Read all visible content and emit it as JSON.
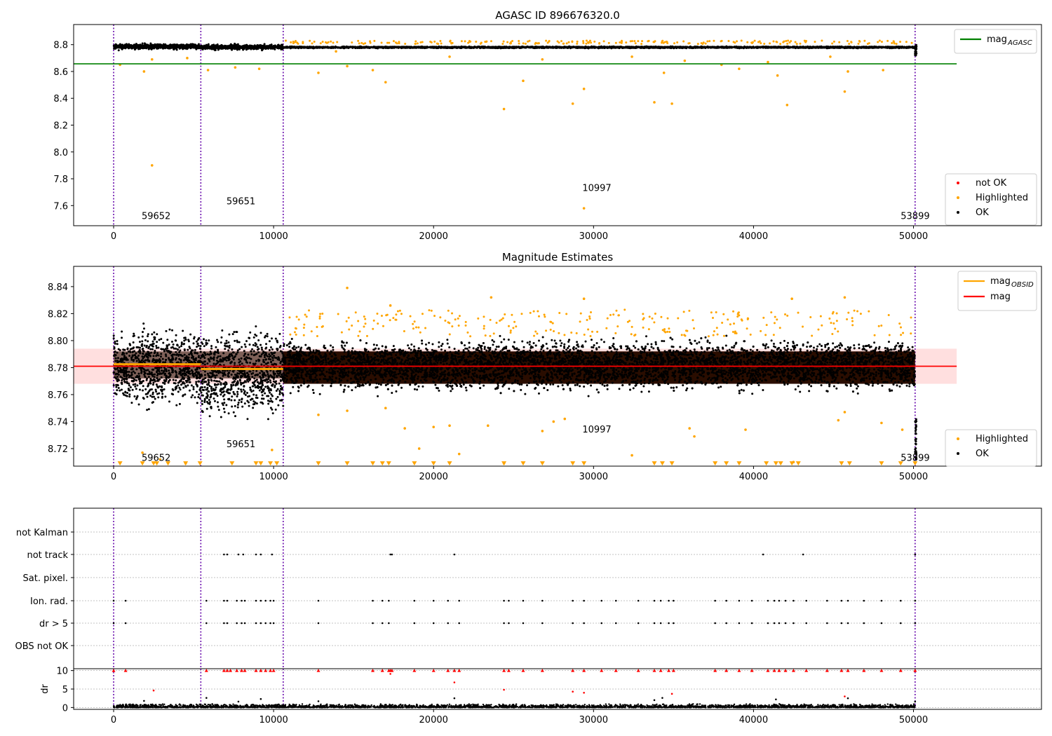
{
  "chart_data": [
    {
      "type": "scatter",
      "title": "AGASC ID 896676320.0",
      "xlim": [
        -2500,
        58000
      ],
      "ylim": [
        7.45,
        8.95
      ],
      "xticks": [
        0,
        10000,
        20000,
        30000,
        40000,
        50000
      ],
      "yticks": [
        7.6,
        7.8,
        8.0,
        8.2,
        8.4,
        8.6,
        8.8
      ],
      "ytick_labels": [
        "7.6",
        "7.8",
        "8.0",
        "8.2",
        "8.4",
        "8.6",
        "8.8"
      ],
      "grid": false,
      "vlines": [
        0,
        5450,
        10600,
        50100
      ],
      "annotations": [
        {
          "label": "59652",
          "x": 1750,
          "y": 7.5
        },
        {
          "label": "59651",
          "x": 7050,
          "y": 7.61
        },
        {
          "label": "10997",
          "x": 29300,
          "y": 7.71
        },
        {
          "label": "53899",
          "x": 49200,
          "y": 7.5
        }
      ],
      "legend_lines": {
        "placement": "top-right",
        "entries": [
          {
            "label": "mag",
            "sub": "AGASC",
            "color": "#008000"
          }
        ]
      },
      "legend_points": {
        "placement": "bottom-right",
        "entries": [
          {
            "label": "not OK",
            "color": "#ff0000"
          },
          {
            "label": "Highlighted",
            "color": "#ffa500"
          },
          {
            "label": "OK",
            "color": "#000000"
          }
        ]
      },
      "lines": [
        {
          "label": "mag AGASC",
          "color": "#008000",
          "x": [
            -2500,
            52700
          ],
          "y": [
            8.657,
            8.657
          ]
        }
      ],
      "series": [
        {
          "name": "OK",
          "color": "#000000",
          "note": "dense band",
          "segments": [
            {
              "x0": 0,
              "x1": 5450,
              "ymin": 8.755,
              "ymax": 8.815
            },
            {
              "x0": 5450,
              "x1": 10600,
              "ymin": 8.755,
              "ymax": 8.81
            },
            {
              "x0": 10600,
              "x1": 50100,
              "ymin": 8.76,
              "ymax": 8.8
            }
          ]
        },
        {
          "name": "Highlighted",
          "color": "#ffa500",
          "points": [
            [
              400,
              8.65
            ],
            [
              1900,
              8.6
            ],
            [
              2400,
              7.9
            ],
            [
              2400,
              8.69
            ],
            [
              4600,
              8.7
            ],
            [
              5900,
              8.61
            ],
            [
              7600,
              8.63
            ],
            [
              9100,
              8.62
            ],
            [
              12800,
              8.59
            ],
            [
              14600,
              8.64
            ],
            [
              16200,
              8.61
            ],
            [
              17000,
              8.52
            ],
            [
              24400,
              8.32
            ],
            [
              25600,
              8.53
            ],
            [
              28700,
              8.36
            ],
            [
              29400,
              8.47
            ],
            [
              29400,
              7.58
            ],
            [
              33800,
              8.37
            ],
            [
              34400,
              8.59
            ],
            [
              34900,
              8.36
            ],
            [
              39100,
              8.62
            ],
            [
              41500,
              8.57
            ],
            [
              42100,
              8.35
            ],
            [
              45700,
              8.45
            ],
            [
              45900,
              8.6
            ],
            [
              48100,
              8.61
            ],
            [
              38000,
              8.65
            ],
            [
              40900,
              8.67
            ],
            [
              26800,
              8.69
            ],
            [
              21000,
              8.71
            ],
            [
              32400,
              8.71
            ],
            [
              35700,
              8.68
            ],
            [
              44800,
              8.71
            ],
            [
              13900,
              8.75
            ]
          ]
        }
      ]
    },
    {
      "type": "scatter",
      "title": "Magnitude Estimates",
      "xlim": [
        -2500,
        58000
      ],
      "ylim": [
        8.707,
        8.855
      ],
      "xticks": [
        0,
        10000,
        20000,
        30000,
        40000,
        50000
      ],
      "yticks": [
        8.72,
        8.74,
        8.76,
        8.78,
        8.8,
        8.82,
        8.84
      ],
      "ytick_labels": [
        "8.72",
        "8.74",
        "8.76",
        "8.78",
        "8.80",
        "8.82",
        "8.84"
      ],
      "grid": false,
      "vlines": [
        0,
        5450,
        10600,
        50100
      ],
      "annotations": [
        {
          "label": "59652",
          "x": 1750,
          "y": 8.711
        },
        {
          "label": "59651",
          "x": 7050,
          "y": 8.721
        },
        {
          "label": "10997",
          "x": 29300,
          "y": 8.732
        },
        {
          "label": "53899",
          "x": 49200,
          "y": 8.711
        }
      ],
      "legend_lines": {
        "placement": "top-right",
        "entries": [
          {
            "label": "mag",
            "sub": "OBSID",
            "color": "#ffa500"
          },
          {
            "label": "mag",
            "sub": "",
            "color": "#ff0000"
          }
        ]
      },
      "legend_points": {
        "placement": "bottom-right",
        "entries": [
          {
            "label": "Highlighted",
            "color": "#ffa500"
          },
          {
            "label": "OK",
            "color": "#000000"
          }
        ]
      },
      "mag_band": {
        "ymin": 8.768,
        "ymax": 8.794,
        "x0": -2500,
        "x1": 52700,
        "color": "#ffc0c0"
      },
      "lines": [
        {
          "label": "mag",
          "color": "#ff0000",
          "x": [
            -2500,
            52700
          ],
          "y": [
            8.781,
            8.781
          ]
        },
        {
          "label": "mag OBSID 1",
          "color": "#ffa500",
          "x": [
            0,
            5450
          ],
          "y": [
            8.7825,
            8.7825
          ]
        },
        {
          "label": "mag OBSID 2",
          "color": "#ffa500",
          "x": [
            5450,
            10600
          ],
          "y": [
            8.779,
            8.779
          ]
        }
      ],
      "series": [
        {
          "name": "OK",
          "color": "#000000",
          "note": "dense band",
          "segments": [
            {
              "x0": 0,
              "x1": 5450,
              "ymin": 8.745,
              "ymax": 8.815
            },
            {
              "x0": 5450,
              "x1": 10600,
              "ymin": 8.735,
              "ymax": 8.815
            },
            {
              "x0": 10600,
              "x1": 50100,
              "ymin": 8.758,
              "ymax": 8.805
            }
          ]
        },
        {
          "name": "Highlighted",
          "color": "#ffa500",
          "points": [
            [
              1800,
              8.717
            ],
            [
              2900,
              8.712
            ],
            [
              4500,
              8.709
            ],
            [
              9900,
              8.719
            ],
            [
              12800,
              8.745
            ],
            [
              14600,
              8.748
            ],
            [
              17000,
              8.75
            ],
            [
              18200,
              8.735
            ],
            [
              19100,
              8.72
            ],
            [
              20000,
              8.736
            ],
            [
              21000,
              8.737
            ],
            [
              21600,
              8.716
            ],
            [
              23400,
              8.737
            ],
            [
              24400,
              8.709
            ],
            [
              26800,
              8.733
            ],
            [
              27500,
              8.74
            ],
            [
              28200,
              8.742
            ],
            [
              32400,
              8.715
            ],
            [
              36000,
              8.735
            ],
            [
              36300,
              8.729
            ],
            [
              39500,
              8.734
            ],
            [
              42500,
              8.71
            ],
            [
              45300,
              8.741
            ],
            [
              45700,
              8.747
            ],
            [
              48000,
              8.739
            ],
            [
              49300,
              8.734
            ],
            [
              14600,
              8.839
            ],
            [
              17300,
              8.826
            ],
            [
              23600,
              8.832
            ],
            [
              29400,
              8.831
            ],
            [
              42400,
              8.831
            ],
            [
              45700,
              8.832
            ]
          ]
        },
        {
          "name": "Highlighted floor",
          "color": "#ffa500",
          "marker": "triangle-down",
          "points": [
            [
              400,
              8.708
            ],
            [
              1800,
              8.708
            ],
            [
              2500,
              8.708
            ],
            [
              2700,
              8.708
            ],
            [
              3400,
              8.708
            ],
            [
              4500,
              8.708
            ],
            [
              5400,
              8.708
            ],
            [
              7400,
              8.708
            ],
            [
              8900,
              8.708
            ],
            [
              9200,
              8.708
            ],
            [
              9800,
              8.708
            ],
            [
              10200,
              8.708
            ],
            [
              12800,
              8.708
            ],
            [
              14600,
              8.708
            ],
            [
              16200,
              8.708
            ],
            [
              16800,
              8.708
            ],
            [
              17200,
              8.708
            ],
            [
              18800,
              8.708
            ],
            [
              20000,
              8.708
            ],
            [
              21000,
              8.708
            ],
            [
              24400,
              8.708
            ],
            [
              25600,
              8.708
            ],
            [
              26800,
              8.708
            ],
            [
              28700,
              8.708
            ],
            [
              29400,
              8.708
            ],
            [
              33800,
              8.708
            ],
            [
              34300,
              8.708
            ],
            [
              34900,
              8.708
            ],
            [
              37600,
              8.708
            ],
            [
              38300,
              8.708
            ],
            [
              39100,
              8.708
            ],
            [
              40800,
              8.708
            ],
            [
              41400,
              8.708
            ],
            [
              41700,
              8.708
            ],
            [
              42400,
              8.708
            ],
            [
              42800,
              8.708
            ],
            [
              45500,
              8.708
            ],
            [
              46000,
              8.708
            ],
            [
              48000,
              8.708
            ],
            [
              49200,
              8.708
            ],
            [
              50100,
              8.708
            ]
          ]
        }
      ]
    },
    {
      "type": "scatter",
      "title": "",
      "xlim": [
        -2500,
        58000
      ],
      "categories": [
        "not Kalman",
        "not track",
        "Sat. pixel.",
        "Ion. rad.",
        "dr > 5",
        "OBS not OK"
      ],
      "grid": true,
      "vlines": [
        0,
        5450,
        10600,
        50100
      ],
      "flags": {
        "not track": [
          6900,
          7100,
          7800,
          8100,
          8900,
          9200,
          9900,
          17300,
          17400,
          21300,
          40600,
          43100,
          50100
        ],
        "Ion. rad.": [
          0,
          750,
          5800,
          6900,
          7100,
          7700,
          8000,
          8200,
          8900,
          9200,
          9500,
          9800,
          10000,
          12800,
          16200,
          16800,
          17200,
          18800,
          20000,
          20900,
          21600,
          24400,
          24700,
          25600,
          26800,
          28700,
          29400,
          30500,
          31400,
          32800,
          33800,
          34200,
          34700,
          35000,
          37600,
          38300,
          39100,
          39900,
          40900,
          41300,
          41600,
          42000,
          42500,
          43300,
          44600,
          45500,
          45900,
          46900,
          48000,
          49200,
          50100
        ],
        "dr > 5": [
          0,
          750,
          5800,
          6900,
          7100,
          7700,
          8000,
          8200,
          8900,
          9200,
          9500,
          9800,
          10000,
          12800,
          16200,
          16800,
          17200,
          18800,
          20000,
          20900,
          21600,
          24400,
          24700,
          25600,
          26800,
          28700,
          29400,
          30500,
          31400,
          32800,
          33800,
          34200,
          34700,
          35000,
          37600,
          38300,
          39100,
          39900,
          40900,
          41300,
          41600,
          42000,
          42500,
          43300,
          44600,
          45500,
          45900,
          46900,
          48000,
          49200,
          50100
        ]
      }
    },
    {
      "type": "scatter",
      "title": "",
      "ylabel": "dr",
      "xlim": [
        -2500,
        58000
      ],
      "ylim": [
        -0.5,
        10.5
      ],
      "xticks": [
        0,
        10000,
        20000,
        30000,
        40000,
        50000
      ],
      "yticks": [
        0,
        5,
        10
      ],
      "ytick_labels": [
        "0",
        "5",
        "10"
      ],
      "grid": true,
      "vlines": [
        0,
        5450,
        10600,
        50100
      ],
      "series": [
        {
          "name": "OK",
          "color": "#000000",
          "note": "dense band near 0",
          "ymin": 0,
          "ymax": 1.0,
          "points": [
            [
              1900,
              1.8
            ],
            [
              5800,
              2.6
            ],
            [
              7800,
              1.6
            ],
            [
              9200,
              2.3
            ],
            [
              12800,
              1.7
            ],
            [
              21300,
              2.5
            ],
            [
              33800,
              2.0
            ],
            [
              34300,
              2.6
            ],
            [
              41400,
              2.2
            ],
            [
              45900,
              2.5
            ],
            [
              50100,
              1.6
            ]
          ]
        },
        {
          "name": "not OK",
          "color": "#ff0000",
          "points": [
            [
              2500,
              4.6
            ],
            [
              21300,
              6.8
            ],
            [
              24400,
              4.8
            ],
            [
              28700,
              4.3
            ],
            [
              29400,
              4.0
            ],
            [
              34900,
              3.7
            ],
            [
              45700,
              3.0
            ],
            [
              17300,
              9.1
            ]
          ]
        },
        {
          "name": "not OK clipped",
          "color": "#ff0000",
          "marker": "triangle-up",
          "y": 10,
          "x": [
            0,
            750,
            5800,
            6900,
            7100,
            7300,
            7700,
            8000,
            8200,
            8900,
            9200,
            9500,
            9800,
            10000,
            12800,
            16200,
            16800,
            17200,
            17300,
            17400,
            18800,
            20000,
            20900,
            21300,
            21600,
            24400,
            24700,
            25600,
            26800,
            28700,
            29400,
            30500,
            31400,
            32800,
            33800,
            34200,
            34700,
            35000,
            37600,
            38300,
            39100,
            39900,
            40900,
            41300,
            41600,
            42000,
            42500,
            43300,
            44600,
            45500,
            45900,
            46900,
            48000,
            49200,
            50100
          ]
        }
      ]
    }
  ]
}
